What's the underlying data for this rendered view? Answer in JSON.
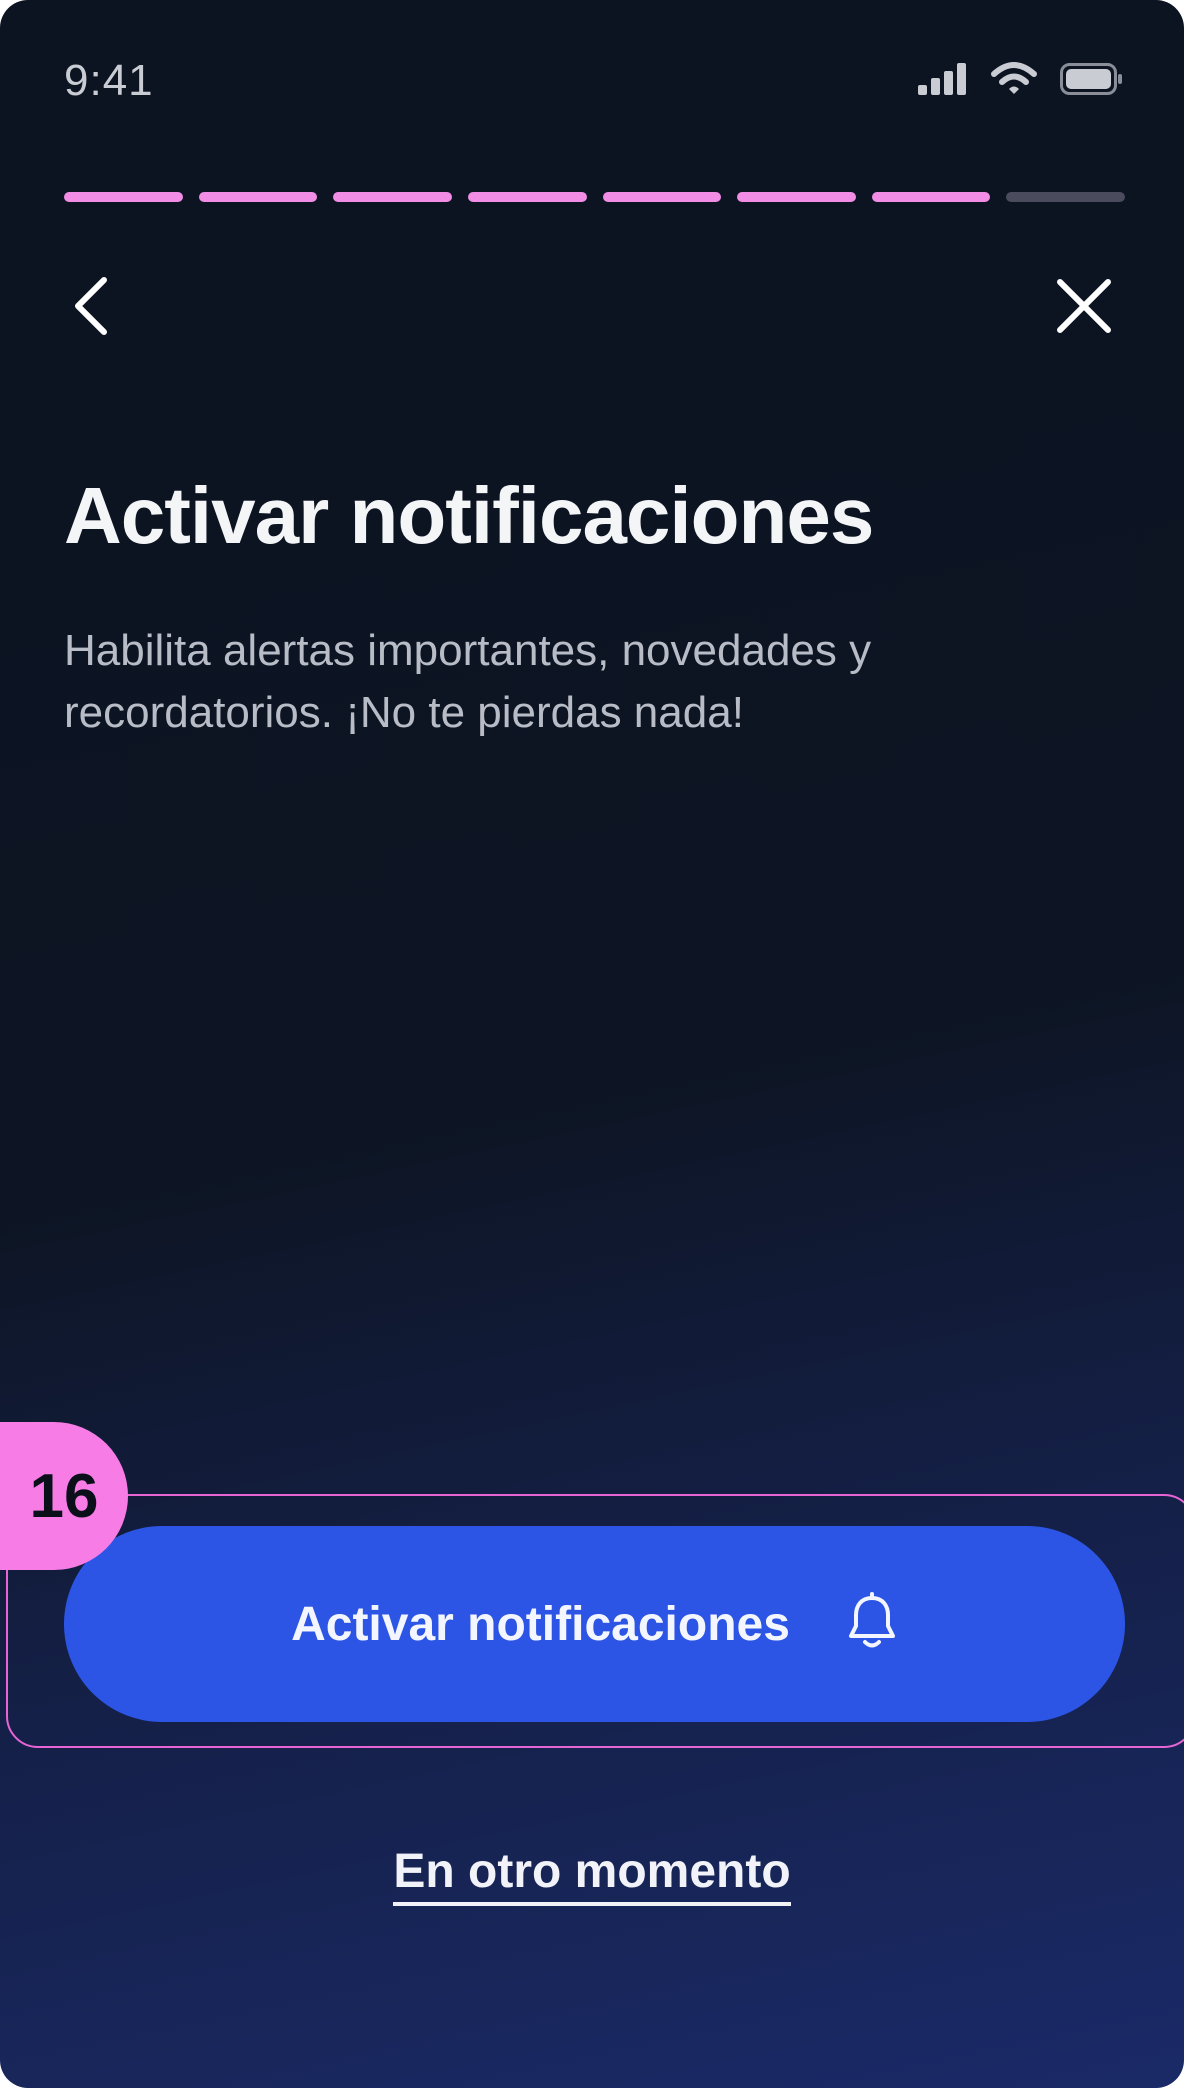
{
  "status_bar": {
    "time": "9:41",
    "icons": [
      "signal-icon",
      "wifi-icon",
      "battery-icon"
    ]
  },
  "progress": {
    "total_steps": 8,
    "completed_steps": 7,
    "active_color": "#f28de6",
    "inactive_color": "#4a4b5c"
  },
  "nav": {
    "back_icon": "chevron-left-icon",
    "close_icon": "close-icon"
  },
  "content": {
    "title": "Activar notificaciones",
    "subtitle": "Habilita alertas importantes, novedades y recordatorios. ¡No te pierdas nada!"
  },
  "annotation": {
    "step_number": "16",
    "color": "#f77ce6"
  },
  "actions": {
    "primary_label": "Activar notificaciones",
    "primary_icon": "bell-icon",
    "primary_color": "#2c55e6",
    "secondary_label": "En otro momento"
  }
}
